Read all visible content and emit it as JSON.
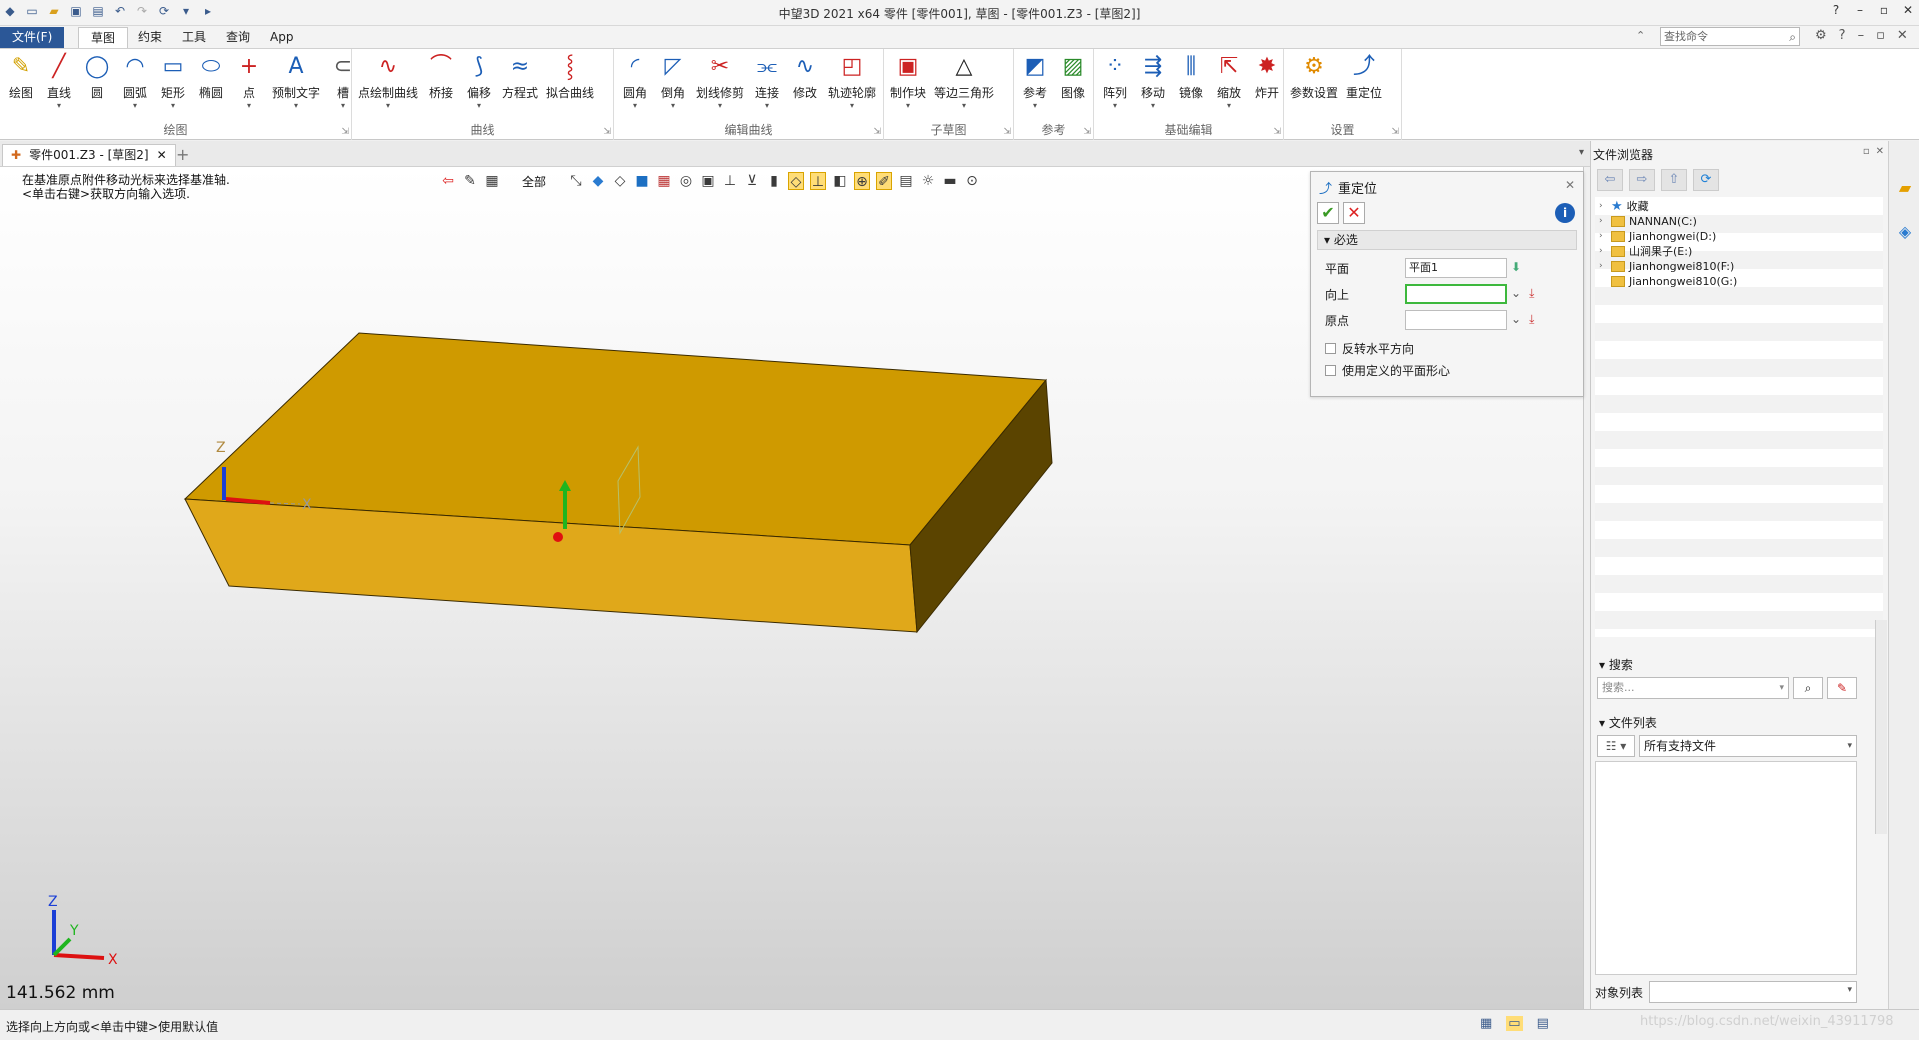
{
  "titlebar": {
    "title": "中望3D 2021 x64       零件 [零件001], 草图 - [零件001.Z3 - [草图2]]",
    "quick_access": [
      "new-icon",
      "open-icon",
      "save-icon",
      "print-icon",
      "undo-icon",
      "redo-icon",
      "refresh-icon",
      "more-icon"
    ],
    "window_controls": [
      "?",
      "▾",
      "–",
      "▫",
      "✕"
    ]
  },
  "menubar": {
    "file": "文件(F)",
    "tabs": [
      "草图",
      "约束",
      "工具",
      "查询",
      "App"
    ],
    "search_placeholder": "查找命令"
  },
  "ribbon": {
    "groups": [
      {
        "name": "绘图",
        "items": [
          {
            "label": "绘图",
            "icon": "pencil-icon",
            "dd": false
          },
          {
            "label": "直线",
            "icon": "line-icon",
            "dd": true
          },
          {
            "label": "圆",
            "icon": "circle-icon",
            "dd": false
          },
          {
            "label": "圆弧",
            "icon": "arc-icon",
            "dd": true
          },
          {
            "label": "矩形",
            "icon": "rect-icon",
            "dd": true
          },
          {
            "label": "椭圆",
            "icon": "ellipse-icon",
            "dd": false
          },
          {
            "label": "点",
            "icon": "point-icon",
            "dd": true
          },
          {
            "label": "预制文字",
            "icon": "text-icon",
            "dd": true
          },
          {
            "label": "槽",
            "icon": "slot-icon",
            "dd": true
          }
        ]
      },
      {
        "name": "曲线",
        "items": [
          {
            "label": "点绘制曲线",
            "icon": "curve-icon",
            "dd": true
          },
          {
            "label": "桥接",
            "icon": "bridge-icon",
            "dd": false
          },
          {
            "label": "偏移",
            "icon": "offset-icon",
            "dd": true
          },
          {
            "label": "方程式",
            "icon": "equation-icon",
            "dd": false
          },
          {
            "label": "拟合曲线",
            "icon": "fit-curve-icon",
            "dd": false
          }
        ]
      },
      {
        "name": "编辑曲线",
        "items": [
          {
            "label": "圆角",
            "icon": "fillet-icon",
            "dd": true
          },
          {
            "label": "倒角",
            "icon": "chamfer-icon",
            "dd": true
          },
          {
            "label": "划线修剪",
            "icon": "trim-icon",
            "dd": true
          },
          {
            "label": "连接",
            "icon": "connect-icon",
            "dd": true
          },
          {
            "label": "修改",
            "icon": "modify-icon",
            "dd": false
          },
          {
            "label": "轨迹轮廓",
            "icon": "profile-icon",
            "dd": true
          }
        ]
      },
      {
        "name": "子草图",
        "items": [
          {
            "label": "制作块",
            "icon": "block-icon",
            "dd": true
          },
          {
            "label": "等边三角形",
            "icon": "triangle-icon",
            "dd": true
          }
        ]
      },
      {
        "name": "参考",
        "items": [
          {
            "label": "参考",
            "icon": "reference-icon",
            "dd": true
          },
          {
            "label": "图像",
            "icon": "image-icon",
            "dd": false
          }
        ]
      },
      {
        "name": "基础编辑",
        "items": [
          {
            "label": "阵列",
            "icon": "array-icon",
            "dd": true
          },
          {
            "label": "移动",
            "icon": "move-icon",
            "dd": true
          },
          {
            "label": "镜像",
            "icon": "mirror-icon",
            "dd": false
          },
          {
            "label": "缩放",
            "icon": "scale-icon",
            "dd": true
          },
          {
            "label": "炸开",
            "icon": "explode-icon",
            "dd": false
          }
        ]
      },
      {
        "name": "设置",
        "items": [
          {
            "label": "参数设置",
            "icon": "settings-icon",
            "dd": false
          },
          {
            "label": "重定位",
            "icon": "reposition-icon",
            "dd": false
          }
        ]
      }
    ]
  },
  "doc_tab": {
    "label": "零件001.Z3 - [草图2]"
  },
  "viewport": {
    "prompt_line1": "在基准原点附件移动光标来选择基准轴.",
    "prompt_line2": "<单击右键>获取方向输入选项.",
    "filter_label": "全部",
    "measure": "141.562 mm",
    "axis_x": "X",
    "axis_y": "Y",
    "axis_z": "Z",
    "colors": {
      "box_top": "#cf9a00",
      "box_front": "#e0a81a",
      "box_side": "#5b4400"
    }
  },
  "dialog": {
    "title": "重定位",
    "section": "必选",
    "fields": [
      {
        "label": "平面",
        "value": "平面1"
      },
      {
        "label": "向上",
        "value": ""
      },
      {
        "label": "原点",
        "value": ""
      }
    ],
    "checkboxes": [
      "反转水平方向",
      "使用定义的平面形心"
    ]
  },
  "file_browser": {
    "title": "文件浏览器",
    "tree": [
      {
        "label": "收藏",
        "type": "favorite"
      },
      {
        "label": "NANNAN(C:)",
        "type": "folder"
      },
      {
        "label": "Jianhongwei(D:)",
        "type": "folder"
      },
      {
        "label": "山涧果子(E:)",
        "type": "folder"
      },
      {
        "label": "Jianhongwei810(F:)",
        "type": "folder"
      },
      {
        "label": "Jianhongwei810(G:)",
        "type": "folder"
      }
    ],
    "search_title": "搜索",
    "search_placeholder": "搜索...",
    "file_list_title": "文件列表",
    "filter_value": "所有支持文件",
    "object_list_label": "对象列表"
  },
  "statusbar": {
    "text": "选择向上方向或<单击中键>使用默认值",
    "watermark": "https://blog.csdn.net/weixin_43911798"
  }
}
